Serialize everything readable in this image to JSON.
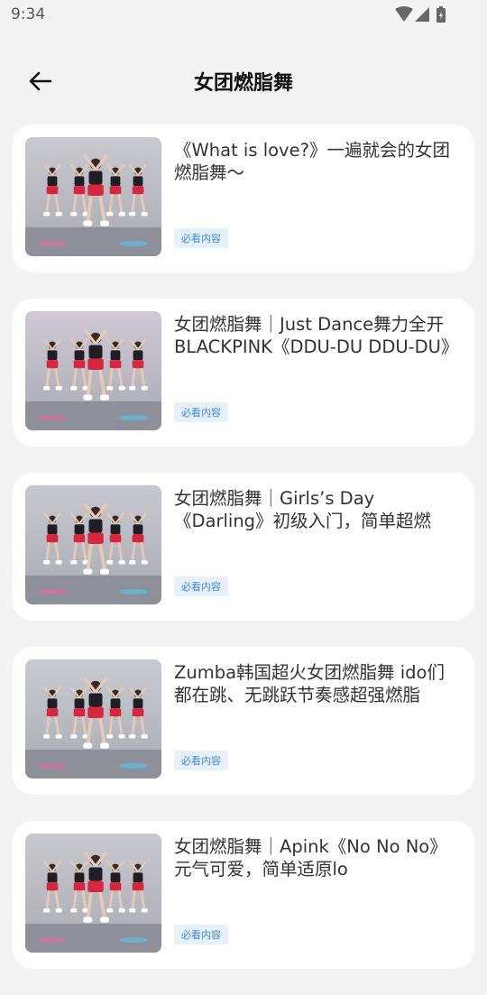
{
  "status_bar": {
    "time": "9:34"
  },
  "header": {
    "title": "女团燃脂舞"
  },
  "videos": [
    {
      "title": "《What is love?》一遍就会的女团燃脂舞～",
      "tag": "必看内容",
      "thumb_colors": [
        "#c9c9cf",
        "#1e1e24",
        "#d7263d"
      ]
    },
    {
      "title": "女团燃脂舞｜Just Dance舞力全开BLACKPINK《DDU-DU DDU-DU》",
      "tag": "必看内容",
      "thumb_colors": [
        "#cfc9d4",
        "#1e1e24",
        "#d7263d"
      ]
    },
    {
      "title": "女团燃脂舞｜Girls’s Day《Darling》初级入门，简单超燃",
      "tag": "必看内容",
      "thumb_colors": [
        "#c7c8cf",
        "#1e1e24",
        "#d7263d"
      ]
    },
    {
      "title": "Zumba韩国超火女团燃脂舞 ido们都在跳、无跳跃节奏感超强燃脂",
      "tag": "必看内容",
      "thumb_colors": [
        "#c9cbd2",
        "#1e1e24",
        "#d7263d"
      ]
    },
    {
      "title": "女团燃脂舞｜Apink《No No No》元气可爱，简单适原lo",
      "tag": "必看内容",
      "thumb_colors": [
        "#c9c9cf",
        "#1e1e24",
        "#d7263d"
      ]
    }
  ]
}
